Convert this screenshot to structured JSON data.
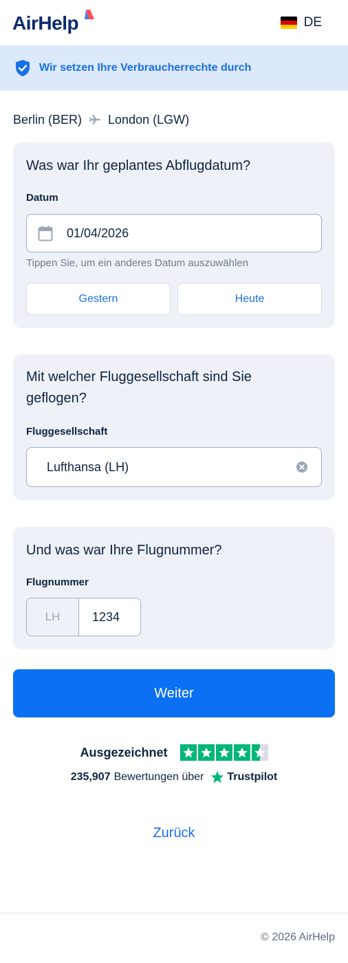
{
  "header": {
    "logo": "AirHelp",
    "language": "DE",
    "flag_colors": [
      "#000000",
      "#dd0000",
      "#ffce00"
    ]
  },
  "banner": {
    "text": "Wir setzen Ihre Verbraucherrechte durch"
  },
  "route": {
    "from": "Berlin (BER)",
    "to": "London (LGW)"
  },
  "date_card": {
    "title": "Was war Ihr geplantes Abflugdatum?",
    "label": "Datum",
    "value": "01/04/2026",
    "hint": "Tippen Sie, um ein anderes Datum auszuwählen",
    "quick_options": [
      "Gestern",
      "Heute"
    ]
  },
  "airline_card": {
    "title": "Mit welcher Fluggesellschaft sind Sie geflogen?",
    "label": "Fluggesellschaft",
    "value": "Lufthansa (LH)"
  },
  "flight_card": {
    "title": "Und was war Ihre Flugnummer?",
    "label": "Flugnummer",
    "prefix": "LH",
    "number": "1234"
  },
  "actions": {
    "continue": "Weiter",
    "back": "Zurück"
  },
  "trustpilot": {
    "rating_label": "Ausgezeichnet",
    "stars": 4.5,
    "count": "235,907",
    "reviews_text": "Bewertungen über",
    "brand": "Trustpilot"
  },
  "footer": {
    "copyright": "© 2026 AirHelp"
  },
  "colors": {
    "accent": "#0b70f4",
    "navy": "#0c2340",
    "banner_bg": "#dce9fb",
    "card_bg": "#eef2f8",
    "trustpilot_green": "#00b67a"
  }
}
